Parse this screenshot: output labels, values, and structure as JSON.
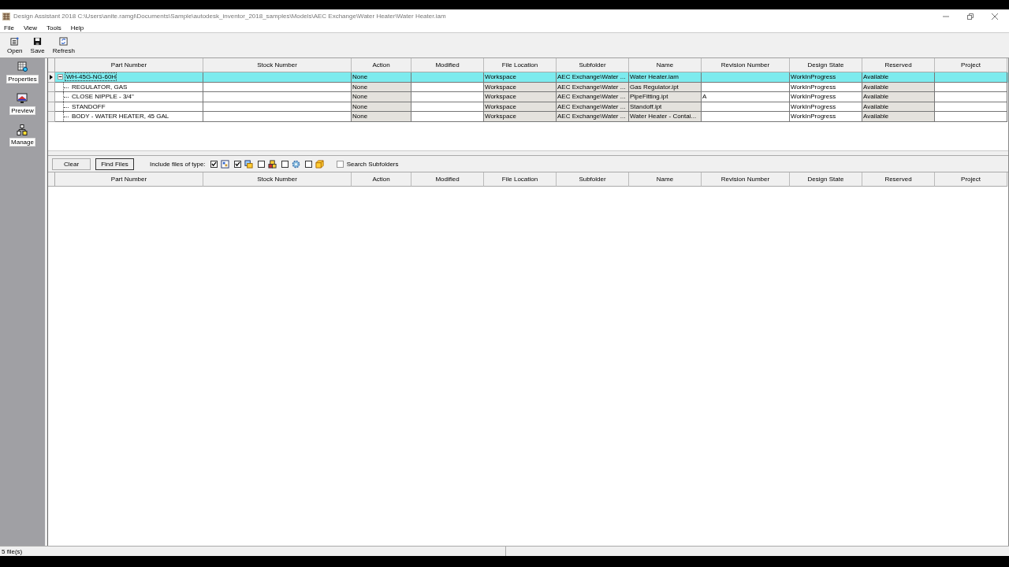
{
  "window": {
    "title": "Design Assistant 2018 C:\\Users\\anite.ramgi\\Documents\\Sample\\autodesk_inventor_2018_samples\\Models\\AEC Exchange\\Water Heater\\Water Heater.iam"
  },
  "menu": [
    "File",
    "View",
    "Tools",
    "Help"
  ],
  "toolbar": [
    "Open",
    "Save",
    "Refresh"
  ],
  "sidebar": {
    "items": [
      "Properties",
      "Preview",
      "Manage"
    ]
  },
  "table": {
    "columns": [
      "Part Number",
      "Stock Number",
      "Action",
      "Modified",
      "File Location",
      "Subfolder",
      "Name",
      "Revision Number",
      "Design State",
      "Reserved",
      "Project"
    ],
    "rows": [
      {
        "part_number": "WH-45G-NG-60H",
        "action": "None",
        "file_location": "Workspace",
        "subfolder": "AEC Exchange\\Water ...",
        "name": "Water Heater.iam",
        "design_state": "WorkInProgress",
        "reserved": "Available",
        "selected": true,
        "expanded": true,
        "children": [
          {
            "part_number": "REGULATOR, GAS",
            "action": "None",
            "file_location": "Workspace",
            "subfolder": "AEC Exchange\\Water ...",
            "name": "Gas Regulator.ipt",
            "design_state": "WorkInProgress",
            "reserved": "Available",
            "selected": false
          },
          {
            "part_number": "CLOSE NIPPLE - 3/4\"",
            "action": "None",
            "file_location": "Workspace",
            "subfolder": "AEC Exchange\\Water ...",
            "name": "PipeFitting.ipt",
            "revision_number": "A",
            "design_state": "WorkInProgress",
            "reserved": "Available",
            "selected": false
          },
          {
            "part_number": "STANDOFF",
            "action": "None",
            "file_location": "Workspace",
            "subfolder": "AEC Exchange\\Water ...",
            "name": "Standoff.ipt",
            "design_state": "WorkInProgress",
            "reserved": "Available",
            "selected": false
          },
          {
            "part_number": "BODY - WATER HEATER, 45 GAL",
            "action": "None",
            "file_location": "Workspace",
            "subfolder": "AEC Exchange\\Water ...",
            "name": "Water Heater - Contai...",
            "design_state": "WorkInProgress",
            "reserved": "Available",
            "selected": false
          }
        ]
      }
    ]
  },
  "search": {
    "buttons": [
      "Clear",
      "Find Files"
    ],
    "filter_label": "Include files of type:",
    "file_types": [
      {
        "checked": true
      },
      {
        "checked": true
      },
      {
        "checked": false
      },
      {
        "checked": false
      },
      {
        "checked": false
      }
    ],
    "subfolders": {
      "label": "Search Subfolders",
      "checked": false
    }
  },
  "results_table": {
    "columns": [
      "Part Number",
      "Stock Number",
      "Action",
      "Modified",
      "File Location",
      "Subfolder",
      "Name",
      "Revision Number",
      "Design State",
      "Reserved",
      "Project"
    ]
  },
  "status_bar": "5 file(s)"
}
